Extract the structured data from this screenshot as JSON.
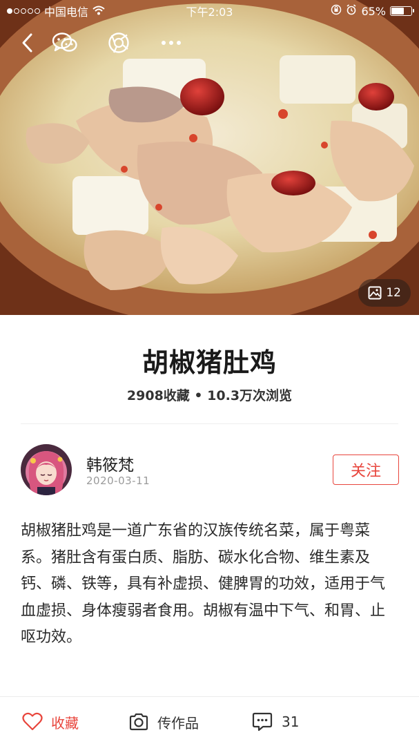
{
  "status_bar": {
    "carrier": "中国电信",
    "time": "下午2:03",
    "battery_percent": "65%",
    "battery_level": 0.65,
    "signal_bars_on": 1,
    "signal_bars_total": 5
  },
  "top_nav": {
    "icons": [
      "back-icon",
      "wechat-icon",
      "moments-icon",
      "more-icon"
    ]
  },
  "hero": {
    "photo_count": "12"
  },
  "recipe": {
    "title": "胡椒猪肚鸡",
    "stats": "2908收藏 • 10.3万次浏览"
  },
  "author": {
    "name": "韩筱梵",
    "date": "2020-03-11",
    "follow_label": "关注"
  },
  "description": "胡椒猪肚鸡是一道广东省的汉族传统名菜，属于粤菜系。猪肚含有蛋白质、脂肪、碳水化合物、维生素及钙、磷、铁等，具有补虚损、健脾胃的功效，适用于气血虚损、身体瘦弱者食用。胡椒有温中下气、和胃、止呕功效。",
  "bottom_bar": {
    "favorite_label": "收藏",
    "upload_label": "传作品",
    "comment_count": "31"
  },
  "colors": {
    "accent": "#e8453c",
    "text": "#222222",
    "muted": "#9a9a9a"
  }
}
